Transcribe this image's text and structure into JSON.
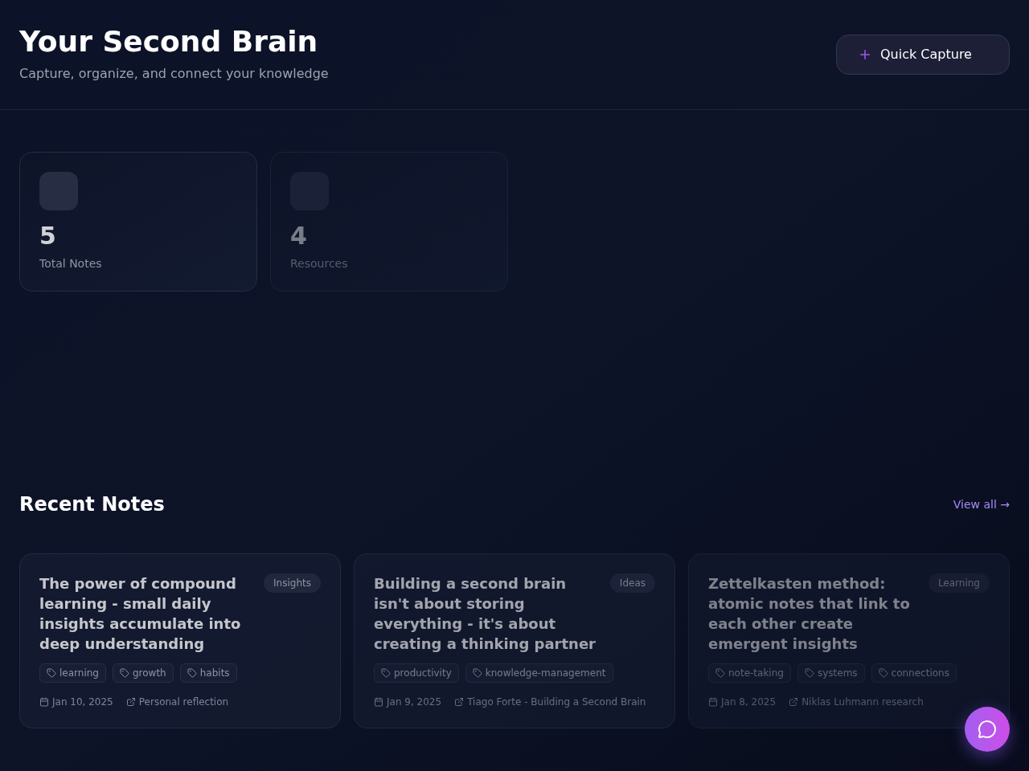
{
  "header": {
    "title": "Your Second Brain",
    "subtitle": "Capture, organize, and connect your knowledge",
    "action": {
      "label": "Quick Capture"
    }
  },
  "stats": [
    {
      "value": "5",
      "label": "Total Notes"
    },
    {
      "value": "4",
      "label": "Resources"
    }
  ],
  "recent_notes": {
    "title": "Recent Notes",
    "link": "View all →",
    "notes": [
      {
        "title": "The power of compound learning - small daily insights accumulate into deep understanding",
        "category": "Insights",
        "tags": [
          "learning",
          "growth",
          "habits"
        ],
        "date": "Jan 10, 2025",
        "source": "Personal reflection"
      },
      {
        "title": "Building a second brain isn't about storing everything - it's about creating a thinking partner",
        "category": "Ideas",
        "tags": [
          "productivity",
          "knowledge-management"
        ],
        "date": "Jan 9, 2025",
        "source": "Tiago Forte - Building a Second Brain"
      },
      {
        "title": "Zettelkasten method: atomic notes that link to each other create emergent insights",
        "category": "Learning",
        "tags": [
          "note-taking",
          "systems",
          "connections"
        ],
        "date": "Jan 8, 2025",
        "source": "Niklas Luhmann research"
      }
    ]
  }
}
